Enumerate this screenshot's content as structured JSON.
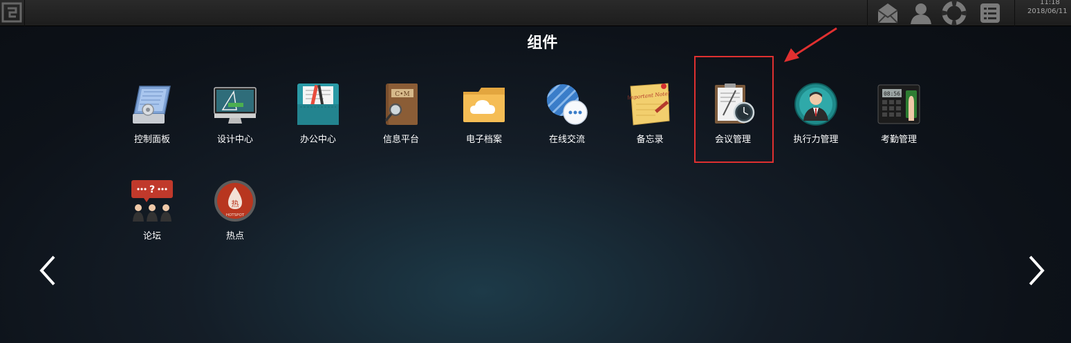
{
  "topbar": {
    "clock_time": "11:18",
    "clock_date": "2018/06/11"
  },
  "page_title": "组件",
  "apps": [
    {
      "label": "控制面板",
      "icon": "control-panel-icon"
    },
    {
      "label": "设计中心",
      "icon": "design-center-icon"
    },
    {
      "label": "办公中心",
      "icon": "office-center-icon"
    },
    {
      "label": "信息平台",
      "icon": "info-platform-icon"
    },
    {
      "label": "电子档案",
      "icon": "e-archive-icon"
    },
    {
      "label": "在线交流",
      "icon": "online-chat-icon"
    },
    {
      "label": "备忘录",
      "icon": "memo-icon",
      "note_text": "Important Note!"
    },
    {
      "label": "会议管理",
      "icon": "meeting-management-icon"
    },
    {
      "label": "执行力管理",
      "icon": "execution-management-icon"
    },
    {
      "label": "考勤管理",
      "icon": "attendance-icon",
      "device_text": "08:56"
    },
    {
      "label": "论坛",
      "icon": "forum-icon"
    },
    {
      "label": "热点",
      "icon": "hotspot-icon",
      "badge_char": "热",
      "badge_text": "HOTSPOT"
    }
  ],
  "info_platform_book_text": "C•M",
  "highlight_color": "#e03030"
}
